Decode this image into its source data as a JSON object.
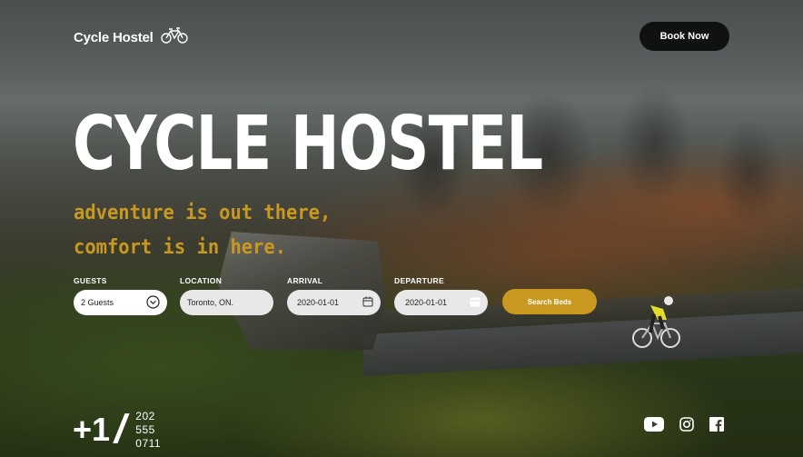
{
  "header": {
    "logo_text": "Cycle Hostel",
    "book_label": "Book Now"
  },
  "hero": {
    "title": "CYCLE HOSTEL",
    "tagline_line1": "adventure is out there,",
    "tagline_line2": "comfort is in here."
  },
  "booking": {
    "guests": {
      "label": "GUESTS",
      "value": "2 Guests"
    },
    "location": {
      "label": "LOCATION",
      "value": "Toronto, ON."
    },
    "arrival": {
      "label": "ARRIVAL",
      "value": "2020-01-01"
    },
    "departure": {
      "label": "DEPARTURE",
      "value": "2020-01-01"
    },
    "search_label": "Search Beds"
  },
  "phone": {
    "code": "+1",
    "line1": "202",
    "line2": "555",
    "line3": "0711"
  },
  "social": {
    "icons": [
      "youtube-icon",
      "instagram-icon",
      "facebook-icon"
    ]
  },
  "colors": {
    "accent": "#c9981f",
    "button_dark": "#0f120f"
  }
}
